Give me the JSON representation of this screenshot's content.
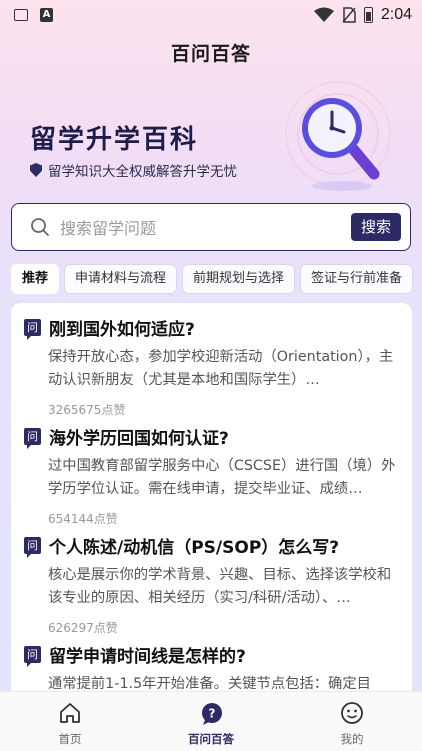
{
  "status_bar": {
    "time": "2:04"
  },
  "header": {
    "title": "百问百答"
  },
  "hero": {
    "title": "留学升学百科",
    "subtitle": "留学知识大全权威解答升学无忧"
  },
  "search": {
    "placeholder": "搜索留学问题",
    "button_label": "搜索"
  },
  "categories": [
    {
      "label": "推荐",
      "active": true
    },
    {
      "label": "申请材料与流程"
    },
    {
      "label": "前期规划与选择"
    },
    {
      "label": "签证与行前准备"
    }
  ],
  "question_icon_label": "问",
  "questions": [
    {
      "title": "刚到国外如何适应?",
      "answer": "保持开放心态，参加学校迎新活动（Orientation），主动认识新朋友（尤其是本地和国际学生）…",
      "likes": "3265675点赞"
    },
    {
      "title": "海外学历回国如何认证?",
      "answer": "过中国教育部留学服务中心（CSCSE）进行国（境）外学历学位认证。需在线申请，提交毕业证、成绩…",
      "likes": "654144点赞"
    },
    {
      "title": "个人陈述/动机信（PS/SOP）怎么写?",
      "answer": "核心是展示你的学术背景、兴趣、目标、选择该学校和该专业的原因、相关经历（实习/科研/活动）、…",
      "likes": "626297点赞"
    },
    {
      "title": "留学申请时间线是怎样的?",
      "answer": "通常提前1-1.5年开始准备。关键节点包括：确定目",
      "likes": ""
    }
  ],
  "bottom_nav": [
    {
      "label": "首页",
      "icon": "home-icon"
    },
    {
      "label": "百问百答",
      "icon": "qa-icon",
      "active": true
    },
    {
      "label": "我的",
      "icon": "profile-icon"
    }
  ],
  "colors": {
    "accent": "#2d2a64",
    "hero_text": "#1e1e4a"
  }
}
